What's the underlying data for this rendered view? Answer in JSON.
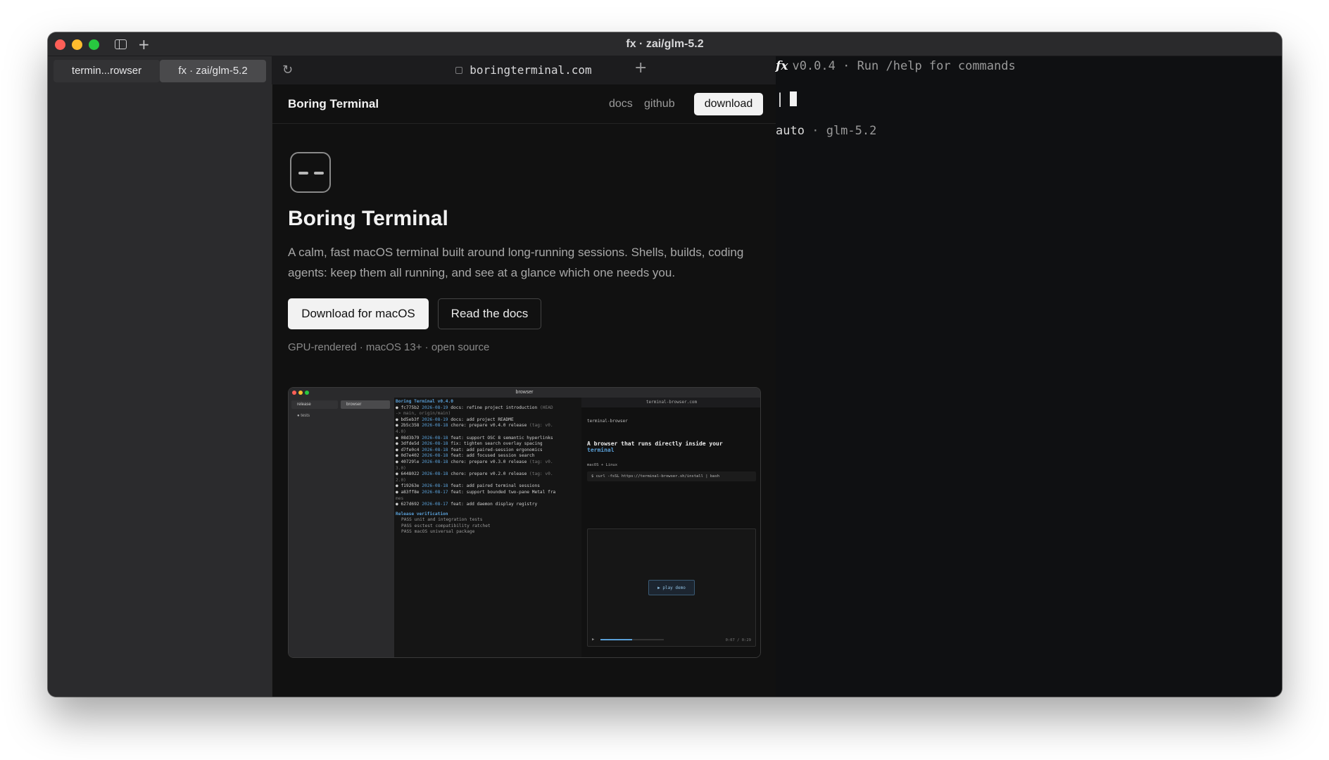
{
  "window": {
    "title": "fx · zai/glm-5.2"
  },
  "sidebar": {
    "tabs": [
      {
        "label": "termin...rowser"
      },
      {
        "label": "fx · zai/glm-5.2"
      }
    ]
  },
  "browser": {
    "url": "boringterminal.com"
  },
  "site": {
    "brand": "Boring Terminal",
    "nav": {
      "docs": "docs",
      "github": "github",
      "download": "download"
    },
    "hero": {
      "title": "Boring Terminal",
      "description": "A calm, fast macOS terminal built around long-running sessions. Shells, builds, coding agents: keep them all running, and see at a glance which one needs you.",
      "primary_button": "Download for macOS",
      "secondary_button": "Read the docs",
      "meta": "GPU-rendered · macOS 13+ · open source"
    },
    "screenshot": {
      "title": "browser",
      "sidebar_tabs": [
        "release",
        "browser"
      ],
      "sidebar_item": "● tests",
      "term_header": "Boring Terminal v0.4.0",
      "commits": [
        {
          "hash": "● fc775b2",
          "date": "2026-08-19",
          "msg": "docs: refine project introduction",
          "tail": "(HEAD"
        },
        {
          "hash": "",
          "date": "",
          "msg": "",
          "tail": "-> main, origin/main)"
        },
        {
          "hash": "● bd5eb3f",
          "date": "2026-08-19",
          "msg": "docs: add project README",
          "tail": ""
        },
        {
          "hash": "● 2b5c358",
          "date": "2026-08-18",
          "msg": "chore: prepare v0.4.0 release",
          "tail": "(tag: v0."
        },
        {
          "hash": "",
          "date": "",
          "msg": "",
          "tail": "4.0)"
        },
        {
          "hash": "● 08d3b79",
          "date": "2026-08-18",
          "msg": "feat: support OSC 8 semantic hyperlinks",
          "tail": ""
        },
        {
          "hash": "● 3dfde5d",
          "date": "2026-08-18",
          "msg": "fix: tighten search overlay spacing",
          "tail": ""
        },
        {
          "hash": "● d7fe0c4",
          "date": "2026-08-18",
          "msg": "feat: add paired-session ergonomics",
          "tail": ""
        },
        {
          "hash": "● 0d7e402",
          "date": "2026-08-18",
          "msg": "feat: add focused session search",
          "tail": ""
        },
        {
          "hash": "● 40729le",
          "date": "2026-08-18",
          "msg": "chore: prepare v0.3.0 release",
          "tail": "(tag: v0."
        },
        {
          "hash": "",
          "date": "",
          "msg": "",
          "tail": "3.0)"
        },
        {
          "hash": "● 6448022",
          "date": "2026-08-18",
          "msg": "chore: prepare v0.2.0 release",
          "tail": "(tag: v0."
        },
        {
          "hash": "",
          "date": "",
          "msg": "",
          "tail": "2.0)"
        },
        {
          "hash": "● f19263e",
          "date": "2026-08-18",
          "msg": "feat: add paired terminal sessions",
          "tail": ""
        },
        {
          "hash": "● a83ff8e",
          "date": "2026-08-17",
          "msg": "feat: support bounded two-pane Metal fra",
          "tail": ""
        },
        {
          "hash": "",
          "date": "",
          "msg": "",
          "tail": "mes"
        },
        {
          "hash": "● 627d692",
          "date": "2026-08-17",
          "msg": "feat: add daemon display registry",
          "tail": ""
        }
      ],
      "verification_header": "Release verification",
      "checks": [
        "PASS  unit and integration tests",
        "PASS  esctest compatibility ratchet",
        "PASS  macOS universal package"
      ],
      "inner_url": "terminal-browser.com",
      "inner_name": "terminal-browser",
      "inner_headline": "A browser that runs directly inside your",
      "inner_headline2": "terminal",
      "inner_badge": "macOS + Linux",
      "inner_cmd": "$ curl -fsSL https://terminal-browser.sh/install | bash",
      "play_label": "▶ play demo",
      "video_time": "0:07 / 0:29"
    }
  },
  "terminal": {
    "fx_glyph": "fx",
    "banner": "v0.0.4 · Run /help for commands",
    "prompt": "|",
    "mode": "auto",
    "separator": "·",
    "model": "glm-5.2"
  }
}
